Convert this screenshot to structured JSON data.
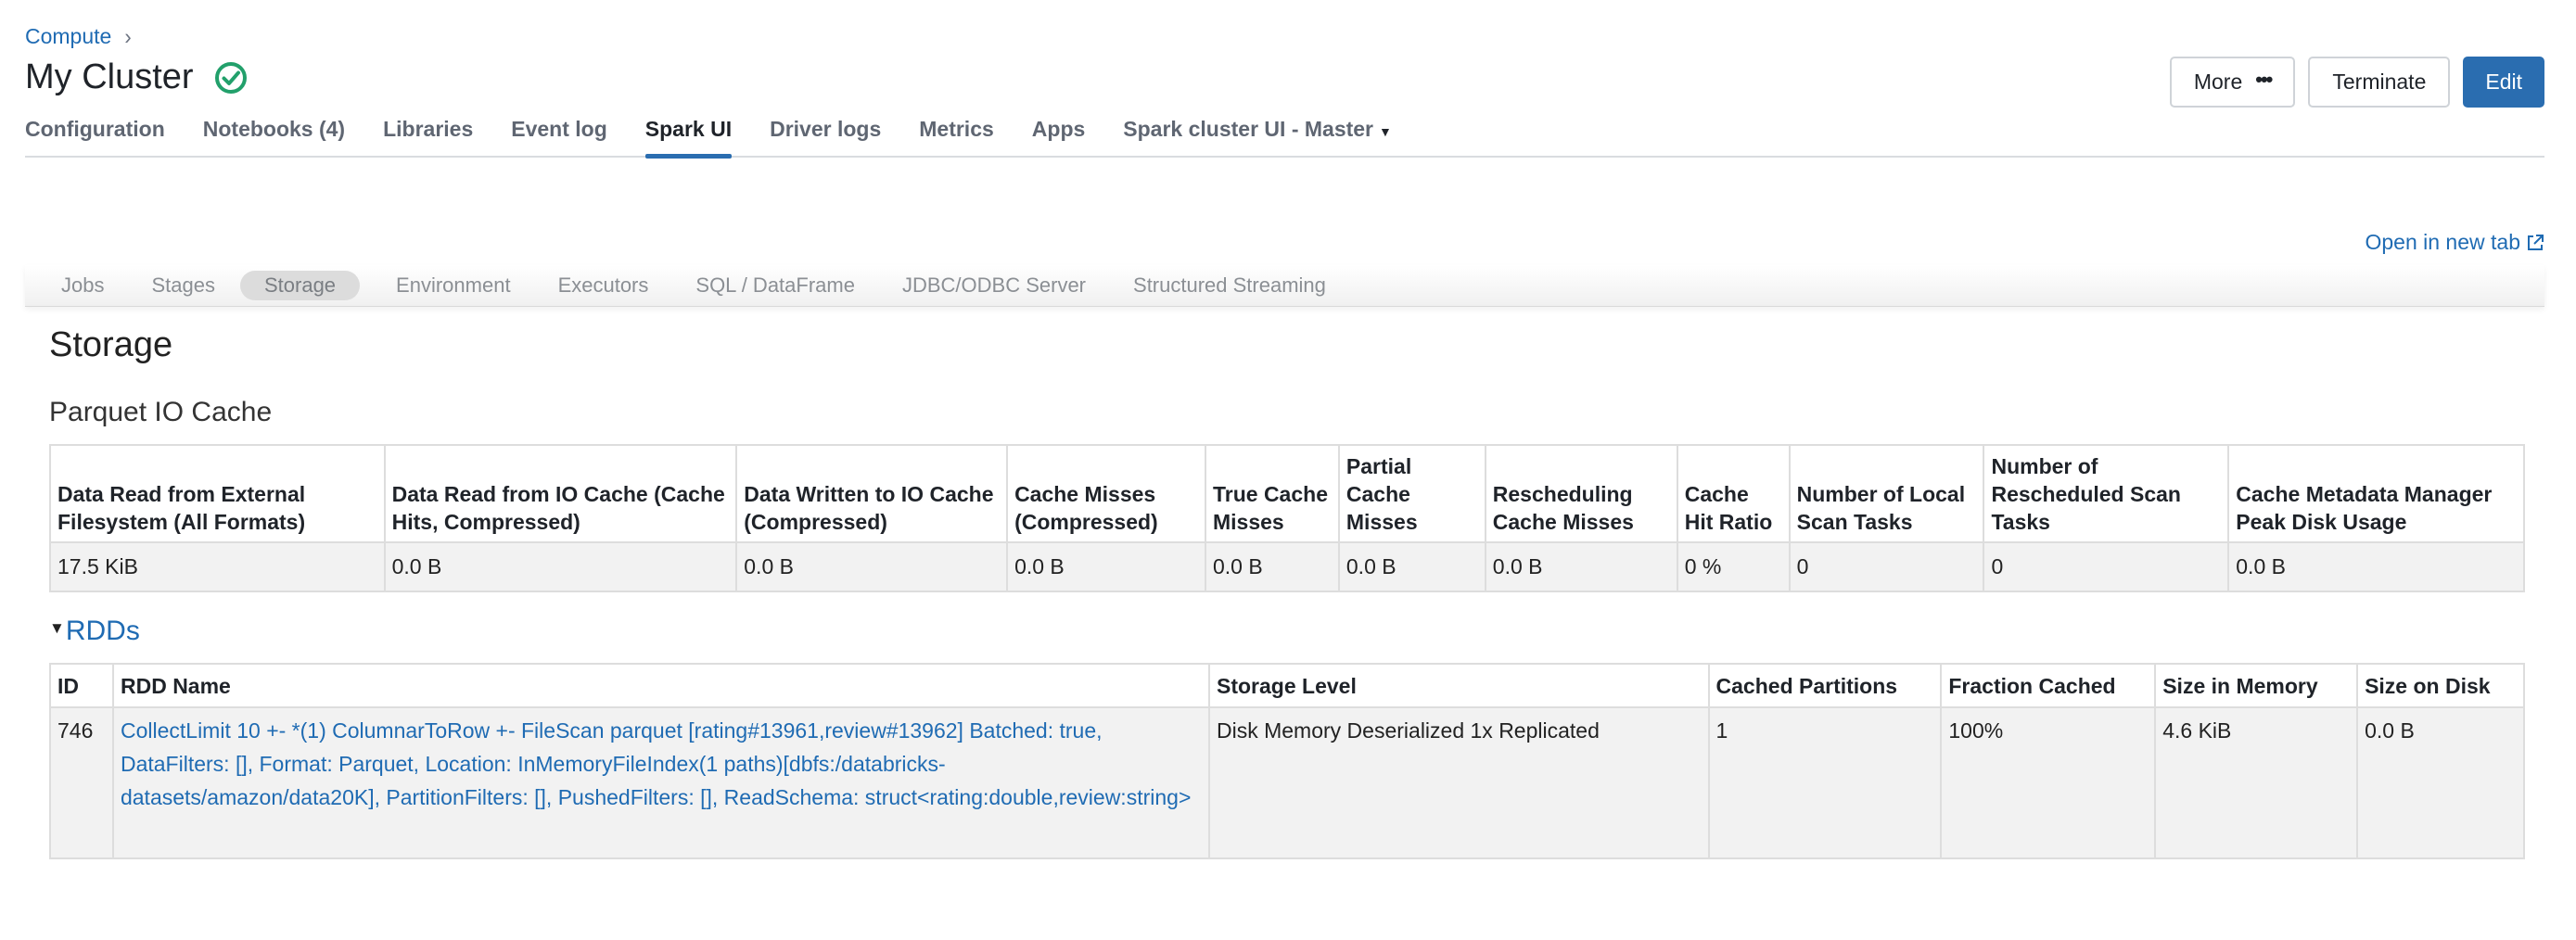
{
  "breadcrumb": {
    "root": "Compute",
    "chevron": "›"
  },
  "page": {
    "title": "My Cluster",
    "status_icon": "check-circle-icon",
    "status_color": "#22a06b"
  },
  "actions": {
    "more": "More",
    "terminate": "Terminate",
    "edit": "Edit"
  },
  "tabs": [
    {
      "label": "Configuration"
    },
    {
      "label": "Notebooks (4)"
    },
    {
      "label": "Libraries"
    },
    {
      "label": "Event log"
    },
    {
      "label": "Spark UI",
      "active": true
    },
    {
      "label": "Driver logs"
    },
    {
      "label": "Metrics"
    },
    {
      "label": "Apps"
    },
    {
      "label": "Spark cluster UI - Master",
      "dropdown": true
    }
  ],
  "open_new_tab": "Open in new tab",
  "spark_nav": [
    "Jobs",
    "Stages",
    "Storage",
    "Environment",
    "Executors",
    "SQL / DataFrame",
    "JDBC/ODBC Server",
    "Structured Streaming"
  ],
  "spark_nav_active": "Storage",
  "storage": {
    "heading": "Storage",
    "parquet_heading": "Parquet IO Cache",
    "cache_table": {
      "headers": [
        "Data Read from External Filesystem (All Formats)",
        "Data Read from IO Cache (Cache Hits, Compressed)",
        "Data Written to IO Cache (Compressed)",
        "Cache Misses (Compressed)",
        "True Cache Misses",
        "Partial Cache Misses",
        "Rescheduling Cache Misses",
        "Cache Hit Ratio",
        "Number of Local Scan Tasks",
        "Number of Rescheduled Scan Tasks",
        "Cache Metadata Manager Peak Disk Usage"
      ],
      "row": [
        "17.5 KiB",
        "0.0 B",
        "0.0 B",
        "0.0 B",
        "0.0 B",
        "0.0 B",
        "0.0 B",
        "0 %",
        "0",
        "0",
        "0.0 B"
      ]
    },
    "rdds_label": "RDDs",
    "rdd_table": {
      "headers": [
        "ID",
        "RDD Name",
        "Storage Level",
        "Cached Partitions",
        "Fraction Cached",
        "Size in Memory",
        "Size on Disk"
      ],
      "row": [
        "746",
        "CollectLimit 10 +- *(1) ColumnarToRow +- FileScan parquet [rating#13961,review#13962] Batched: true, DataFilters: [], Format: Parquet, Location: InMemoryFileIndex(1 paths)[dbfs:/databricks-datasets/amazon/data20K], PartitionFilters: [], PushedFilters: [], ReadSchema: struct<rating:double,review:string>",
        "Disk Memory Deserialized 1x Replicated",
        "1",
        "100%",
        "4.6 KiB",
        "0.0 B"
      ]
    }
  },
  "colors": {
    "link": "#1f6bb3",
    "primary_button": "#2a6db0",
    "active_tab_underline": "#2a6db0"
  }
}
